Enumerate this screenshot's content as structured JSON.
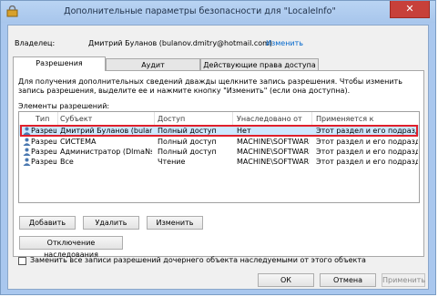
{
  "window": {
    "title": "Дополнительные параметры безопасности  для \"LocaleInfo\"",
    "close_glyph": "✕"
  },
  "owner": {
    "label": "Владелец:",
    "value": "Дмитрий Буланов (bulanov.dmitry@hotmail.com)",
    "change_link": "Изменить"
  },
  "tabs": [
    {
      "label": "Разрешения",
      "active": true
    },
    {
      "label": "Аудит",
      "active": false
    },
    {
      "label": "Действующие права доступа",
      "active": false
    }
  ],
  "permissions": {
    "info_text": "Для получения дополнительных сведений дважды щелкните запись разрешения. Чтобы изменить запись разрешения, выделите ее и нажмите кнопку \"Изменить\" (если она доступна).",
    "list_label": "Элементы разрешений:",
    "columns": [
      "Тип",
      "Субъект",
      "Доступ",
      "Унаследовано от",
      "Применяется к"
    ],
    "rows": [
      {
        "type": "Разреш...",
        "subject": "Дмитрий Буланов (bulanov....",
        "access": "Полный доступ",
        "inherited": "Нет",
        "applies": "Этот раздел и его подразделы",
        "selected": true
      },
      {
        "type": "Разреш...",
        "subject": "СИСТЕМА",
        "access": "Полный доступ",
        "inherited": "MACHINE\\SOFTWARE\\...",
        "applies": "Этот раздел и его подразделы",
        "selected": false
      },
      {
        "type": "Разреш...",
        "subject": "Администратор (DlmaNs-net...",
        "access": "Полный доступ",
        "inherited": "MACHINE\\SOFTWARE\\...",
        "applies": "Этот раздел и его подразделы",
        "selected": false
      },
      {
        "type": "Разреш...",
        "subject": "Все",
        "access": "Чтение",
        "inherited": "MACHINE\\SOFTWARE\\...",
        "applies": "Этот раздел и его подразделы",
        "selected": false
      }
    ],
    "buttons": {
      "add": "Добавить",
      "remove": "Удалить",
      "edit": "Изменить"
    },
    "disable_inheritance": "Отключение наследования"
  },
  "replace_checkbox": {
    "label": "Заменить все записи разрешений дочернего объекта наследуемыми от этого объекта",
    "checked": false
  },
  "footer": {
    "ok": "ОК",
    "cancel": "Отмена",
    "apply": "Применить"
  },
  "colors": {
    "selection": "#cde8ff",
    "highlight_frame": "#e0202c",
    "link": "#0066cc",
    "close": "#c7403a"
  },
  "icons": [
    "lock-shield-icon",
    "user-icon"
  ]
}
